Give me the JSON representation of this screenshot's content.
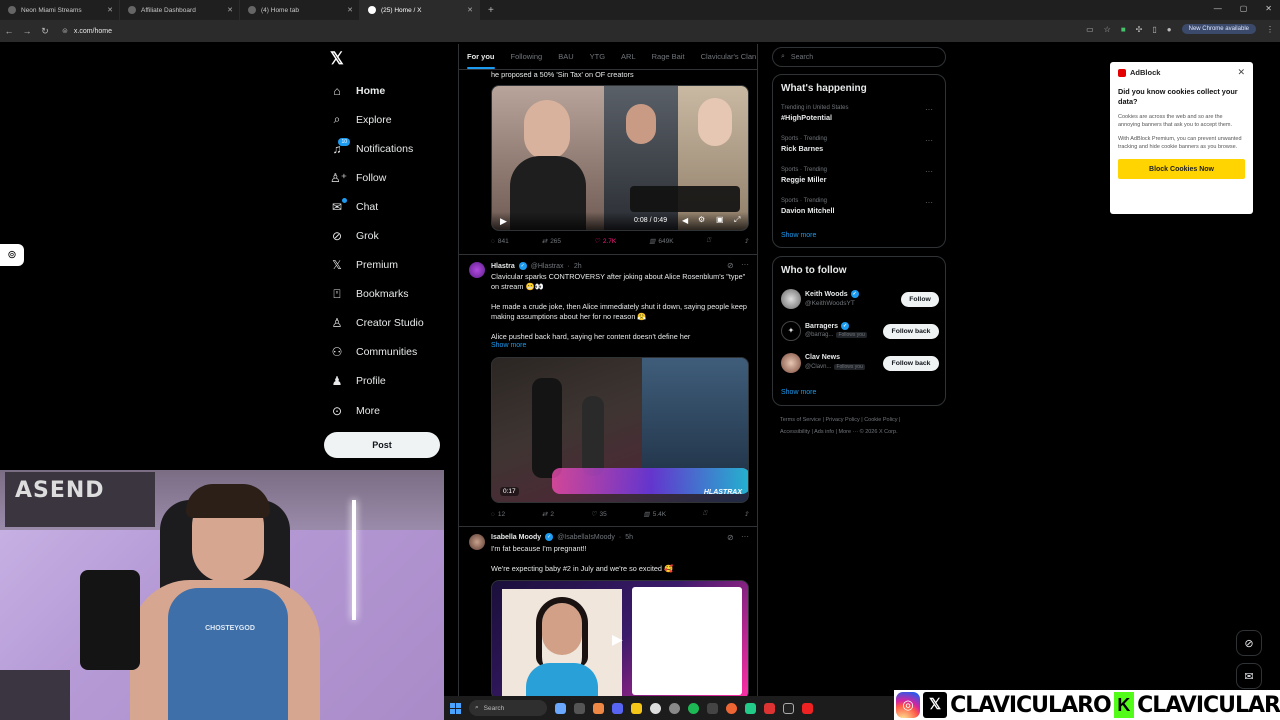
{
  "browser": {
    "tabs": [
      {
        "title": "Neon Miami Streams",
        "active": false
      },
      {
        "title": "Affiliate Dashboard",
        "active": false
      },
      {
        "title": "(4) Home tab",
        "active": false
      },
      {
        "title": "(25) Home / X",
        "active": true
      }
    ],
    "url": "x.com/home",
    "new_chrome": "New Chrome available"
  },
  "nav": {
    "items": [
      {
        "label": "Home",
        "icon": "home-icon",
        "glyph": "⌂",
        "bold": true
      },
      {
        "label": "Explore",
        "icon": "search-icon",
        "glyph": "⌕"
      },
      {
        "label": "Notifications",
        "icon": "bell-icon",
        "glyph": "🔔",
        "badge": "10"
      },
      {
        "label": "Follow",
        "icon": "add-person-icon",
        "glyph": "⁺"
      },
      {
        "label": "Chat",
        "icon": "mail-icon",
        "glyph": "✉"
      },
      {
        "label": "Grok",
        "icon": "grok-icon",
        "glyph": "⊘"
      },
      {
        "label": "Premium",
        "icon": "x-premium-icon",
        "glyph": "𝕏"
      },
      {
        "label": "Bookmarks",
        "icon": "bookmark-icon",
        "glyph": "⌑"
      },
      {
        "label": "Creator Studio",
        "icon": "creator-studio-icon",
        "glyph": "♙"
      },
      {
        "label": "Communities",
        "icon": "communities-icon",
        "glyph": "⚇"
      },
      {
        "label": "Profile",
        "icon": "profile-icon",
        "glyph": "♟"
      },
      {
        "label": "More",
        "icon": "more-circle-icon",
        "glyph": "⊙"
      }
    ],
    "post_button": "Post"
  },
  "feed": {
    "tabs": [
      "For you",
      "Following",
      "BAU",
      "YTG",
      "ARL",
      "Rage Bait",
      "Clavicular's Clan"
    ],
    "post1": {
      "text": "he proposed a 50% 'Sin Tax' on OF creators",
      "video_time": "0:08 / 0:49",
      "replies": "841",
      "reposts": "265",
      "likes": "2.7K",
      "views": "649K"
    },
    "post2": {
      "name": "Hlastra",
      "handle": "@Hlastrax",
      "time": "2h",
      "line1": "Clavicular sparks CONTROVERSY after joking about Alice Rosenblum's \"type\" on stream 😬👀",
      "line2": "He made a crude joke, then Alice immediately shut it down, saying people keep making assumptions about her for no reason 😤",
      "line3": "Alice pushed back hard, saying her content doesn't define her",
      "show_more": "Show more",
      "duration": "0:17",
      "watermark": "HLASTRAX",
      "replies": "12",
      "reposts": "2",
      "likes": "35",
      "views": "5.4K"
    },
    "post3": {
      "name": "Isabella Moody",
      "handle": "@IsabellaIsMoody",
      "time": "5h",
      "line1": "I'm fat because I'm pregnant!!",
      "line2": "We're expecting baby #2 in July and we're so excited 🥰"
    }
  },
  "search": {
    "placeholder": "Search"
  },
  "whats_happening": {
    "title": "What's happening",
    "trends": [
      {
        "meta": "Trending in United States",
        "name": "#HighPotential"
      },
      {
        "meta": "Sports · Trending",
        "name": "Rick Barnes"
      },
      {
        "meta": "Sports · Trending",
        "name": "Reggie Miller"
      },
      {
        "meta": "Sports · Trending",
        "name": "Davion Mitchell"
      }
    ],
    "show_more": "Show more"
  },
  "who_to_follow": {
    "title": "Who to follow",
    "accounts": [
      {
        "name": "Keith Woods",
        "handle": "@KeithWoodsYT",
        "button": "Follow",
        "follows_you": ""
      },
      {
        "name": "Barragers",
        "handle": "@barrag...",
        "button": "Follow back",
        "follows_you": "Follows you"
      },
      {
        "name": "Clav News",
        "handle": "@Clavn...",
        "button": "Follow back",
        "follows_you": "Follows you"
      }
    ],
    "show_more": "Show more"
  },
  "footer": {
    "line1": [
      "Terms of Service",
      "Privacy Policy",
      "Cookie Policy"
    ],
    "line2": [
      "Accessibility",
      "Ads info",
      "More ···",
      "© 2026 X Corp."
    ]
  },
  "adblock": {
    "brand": "AdBlock",
    "question": "Did you know cookies collect your data?",
    "p1": "Cookies are across the web and so are the annoying banners that ask you to accept them.",
    "p2": "With AdBlock Premium, you can prevent unwanted tracking and hide cookie banners as you browse.",
    "cta": "Block Cookies Now"
  },
  "webcam": {
    "banner": "ASEND",
    "shirt": "CHOSTEYGOD"
  },
  "taskbar": {
    "search": "Search"
  },
  "overlay": {
    "text1": "CLAVICULARO",
    "text2": "CLAVICULAR"
  },
  "colors": {
    "accent": "#1d9bf0",
    "like": "#f91880",
    "kick": "#53fc18",
    "adblock_cta": "#ffd400"
  }
}
